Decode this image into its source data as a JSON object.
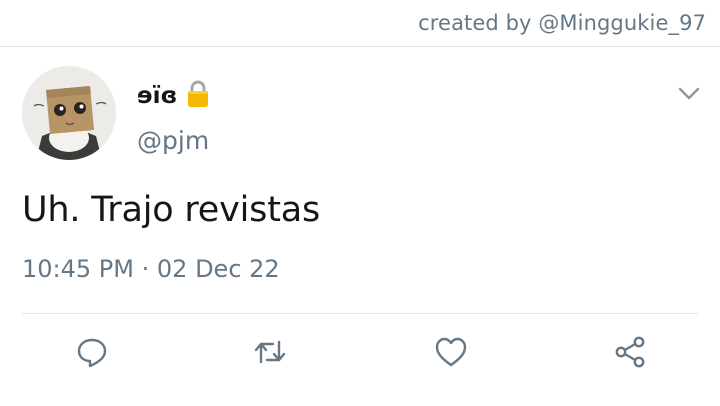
{
  "credit": {
    "text": "created by @Minggukie_97"
  },
  "tweet": {
    "author": {
      "display_name": "ɘïɞ",
      "handle": "@pjm",
      "avatar_icon": "avatar-image",
      "protected_icon": "lock-icon"
    },
    "text": "Uh. Trajo revistas",
    "time": "10:45 PM",
    "separator": "·",
    "date": "02 Dec 22"
  },
  "actions": [
    {
      "name": "reply",
      "icon": "reply-icon"
    },
    {
      "name": "retweet",
      "icon": "retweet-icon"
    },
    {
      "name": "like",
      "icon": "heart-icon"
    },
    {
      "name": "share",
      "icon": "share-icon"
    }
  ],
  "colors": {
    "text": "#14171a",
    "secondary": "#657786",
    "icon": "#657786",
    "divider": "#e1e8ed",
    "lock": "#f5b800"
  }
}
